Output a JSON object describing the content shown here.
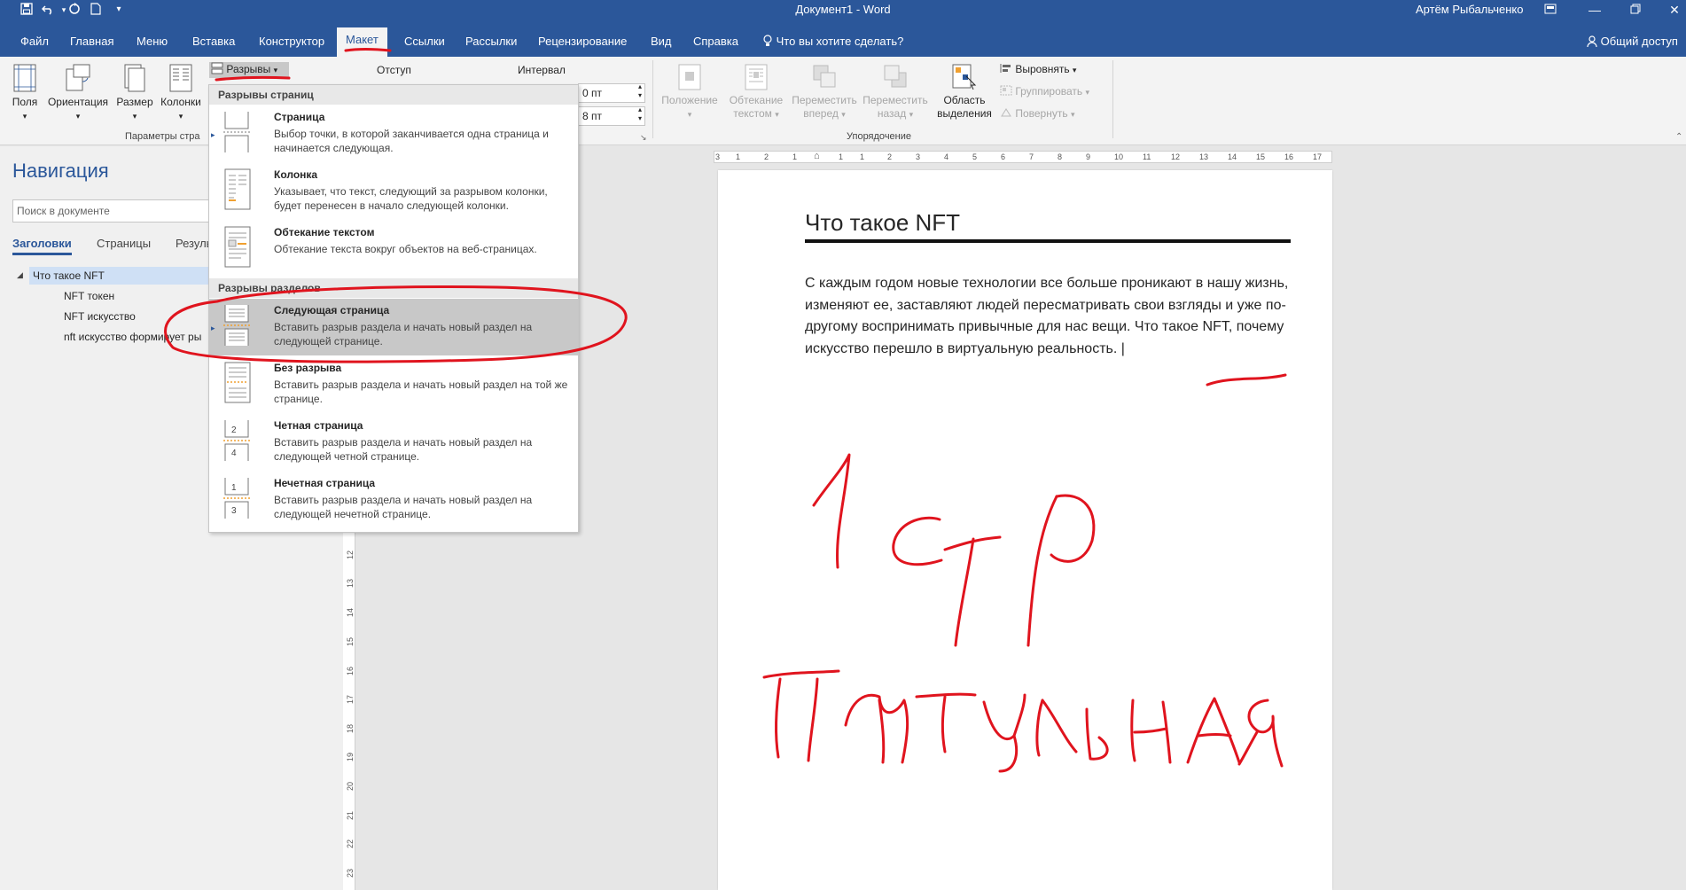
{
  "titlebar": {
    "title": "Документ1 - Word",
    "user": "Артём Рыбальченко",
    "qa_icons": [
      "save-icon",
      "undo-icon",
      "redo-icon",
      "new-doc-icon",
      "customize-icon"
    ],
    "window_controls": [
      "ribbon-display-icon",
      "minimize-icon",
      "restore-icon",
      "close-icon"
    ]
  },
  "tabs": [
    "Файл",
    "Главная",
    "Меню",
    "Вставка",
    "Конструктор",
    "Макет",
    "Ссылки",
    "Рассылки",
    "Рецензирование",
    "Вид",
    "Справка"
  ],
  "active_tab": "Макет",
  "tell_me": "Что вы хотите сделать?",
  "share": "Общий доступ",
  "ribbon": {
    "page_setup": {
      "buttons": [
        "Поля",
        "Ориентация",
        "Размер",
        "Колонки"
      ],
      "breaks_label": "Разрывы",
      "group_label": "Параметры стра"
    },
    "indent_label": "Отступ",
    "spacing_label": "Интервал",
    "spacing_before": "0 пт",
    "spacing_after": "8 пт",
    "arrange": {
      "position": [
        "Положение"
      ],
      "wrap": [
        "Обтекание",
        "текстом"
      ],
      "forward": [
        "Переместить",
        "вперед"
      ],
      "backward": [
        "Переместить",
        "назад"
      ],
      "selection": [
        "Область",
        "выделения"
      ],
      "align": "Выровнять",
      "group": "Группировать",
      "rotate": "Повернуть",
      "group_label": "Упорядочение"
    }
  },
  "nav": {
    "title": "Навигация",
    "search_placeholder": "Поиск в документе",
    "tabs": [
      "Заголовки",
      "Страницы",
      "Резуль"
    ],
    "headings": [
      {
        "text": "Что такое NFT",
        "level": 1
      },
      {
        "text": "NFT токен",
        "level": 2
      },
      {
        "text": "NFT искусство",
        "level": 2
      },
      {
        "text": "nft искусство формирует ры",
        "level": 2
      }
    ]
  },
  "dropdown": {
    "section_page": "Разрывы страниц",
    "section_section": "Разрывы разделов",
    "page_breaks": [
      {
        "title": "Страница",
        "desc": "Выбор точки, в которой заканчивается одна страница и начинается следующая."
      },
      {
        "title": "Колонка",
        "desc": "Указывает, что текст, следующий за разрывом колонки, будет перенесен в начало следующей колонки."
      },
      {
        "title": "Обтекание текстом",
        "desc": "Обтекание текста вокруг объектов на веб-страницах."
      }
    ],
    "section_breaks": [
      {
        "title": "Следующая страница",
        "desc": "Вставить разрыв раздела и начать новый раздел на следующей странице."
      },
      {
        "title": "Без разрыва",
        "desc": "Вставить разрыв раздела и начать новый раздел на той же странице."
      },
      {
        "title": "Четная страница",
        "desc": "Вставить разрыв раздела и начать новый раздел на следующей четной странице."
      },
      {
        "title": "Нечетная страница",
        "desc": "Вставить разрыв раздела и начать новый раздел на следующей нечетной странице."
      }
    ]
  },
  "hruler_ticks": [
    "3",
    "1",
    "2",
    "1",
    "1",
    "1",
    "2",
    "3",
    "4",
    "5",
    "6",
    "7",
    "8",
    "9",
    "10",
    "11",
    "12",
    "13",
    "14",
    "15",
    "16",
    "17"
  ],
  "vruler_ticks": [
    "12",
    "13",
    "14",
    "15",
    "16",
    "17",
    "18",
    "19",
    "20",
    "21",
    "22",
    "23"
  ],
  "document": {
    "heading": "Что такое NFT",
    "body": "С каждым годом новые технологии все больше проникают в нашу жизнь, изменяют ее, заставляют людей пересматривать свои взгляды и уже по-другому воспринимать привычные для нас вещи. Что такое NFT, почему искусство перешло в виртуальную реальность. |"
  },
  "colors": {
    "accent": "#2b579a",
    "annotation": "#e0141e"
  }
}
